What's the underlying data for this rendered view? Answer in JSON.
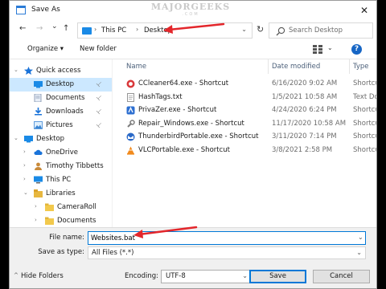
{
  "window": {
    "title": "Save As",
    "close_glyph": "✕",
    "watermark": {
      "main": "MAJORGEEKS",
      "sub": ".COM"
    }
  },
  "address_bar": {
    "back_glyph": "←",
    "forward_glyph": "→",
    "dropdown_glyph": "⌄",
    "up_glyph": "↑",
    "breadcrumbs": [
      "This PC",
      "Desktop"
    ],
    "separator": "›",
    "refresh_glyph": "↻",
    "search_placeholder": "Search Desktop"
  },
  "toolbar": {
    "organize_label": "Organize ▾",
    "new_folder_label": "New folder",
    "help_glyph": "?"
  },
  "nav_pane": {
    "items": [
      {
        "label": "Quick access",
        "icon": "star-icon",
        "chevron": "⌄",
        "pinned": false
      },
      {
        "label": "Desktop",
        "icon": "desktop-folder-icon",
        "chevron": "",
        "pinned": true,
        "selected": true
      },
      {
        "label": "Documents",
        "icon": "documents-icon",
        "chevron": "",
        "pinned": true
      },
      {
        "label": "Downloads",
        "icon": "download-icon",
        "chevron": "",
        "pinned": true
      },
      {
        "label": "Pictures",
        "icon": "pictures-icon",
        "chevron": "",
        "pinned": true
      },
      {
        "label": "Desktop",
        "icon": "desktop-folder-icon",
        "chevron": "⌄",
        "pinned": false
      },
      {
        "label": "OneDrive",
        "icon": "cloud-icon",
        "chevron": "›",
        "pinned": false
      },
      {
        "label": "Timothy Tibbetts",
        "icon": "user-icon",
        "chevron": "›",
        "pinned": false
      },
      {
        "label": "This PC",
        "icon": "pc-icon",
        "chevron": "›",
        "pinned": false
      },
      {
        "label": "Libraries",
        "icon": "library-icon",
        "chevron": "⌄",
        "pinned": false
      },
      {
        "label": "CameraRoll",
        "icon": "folder-icon",
        "chevron": "›",
        "pinned": false
      },
      {
        "label": "Documents",
        "icon": "folder-icon",
        "chevron": "›",
        "pinned": false
      }
    ],
    "pin_glyph": "📌"
  },
  "file_list": {
    "columns": [
      "Name",
      "Date modified",
      "Type"
    ],
    "sort_caret": "^",
    "rows": [
      {
        "name": "CCleaner64.exe - Shortcut",
        "date": "6/16/2020 9:02 AM",
        "type": "Shortcut",
        "icon": "ccleaner-icon"
      },
      {
        "name": "HashTags.txt",
        "date": "1/5/2021 10:58 AM",
        "type": "Text Doc",
        "icon": "text-file-icon"
      },
      {
        "name": "PrivaZer.exe - Shortcut",
        "date": "4/24/2020 6:24 PM",
        "type": "Shortcut",
        "icon": "privazer-icon"
      },
      {
        "name": "Repair_Windows.exe - Shortcut",
        "date": "11/17/2020 10:58 AM",
        "type": "Shortcut",
        "icon": "wrench-icon"
      },
      {
        "name": "ThunderbirdPortable.exe - Shortcut",
        "date": "3/11/2020 7:14 PM",
        "type": "Shortcut",
        "icon": "thunderbird-icon"
      },
      {
        "name": "VLCPortable.exe - Shortcut",
        "date": "3/8/2021 2:58 PM",
        "type": "Shortcut",
        "icon": "vlc-icon"
      }
    ]
  },
  "bottom": {
    "file_name_label": "File name:",
    "file_name_value": "Websites.bat",
    "save_as_type_label": "Save as type:",
    "save_as_type_value": "All Files  (*.*)",
    "encoding_label": "Encoding:",
    "encoding_value": "UTF-8",
    "save_label": "Save",
    "cancel_label": "Cancel",
    "hide_folders_label": "Hide Folders",
    "hide_caret": "^",
    "dropdown_glyph": "⌄"
  },
  "colors": {
    "accent": "#0078d7",
    "selection": "#cce8ff",
    "annotation_arrow": "#e3262b"
  }
}
